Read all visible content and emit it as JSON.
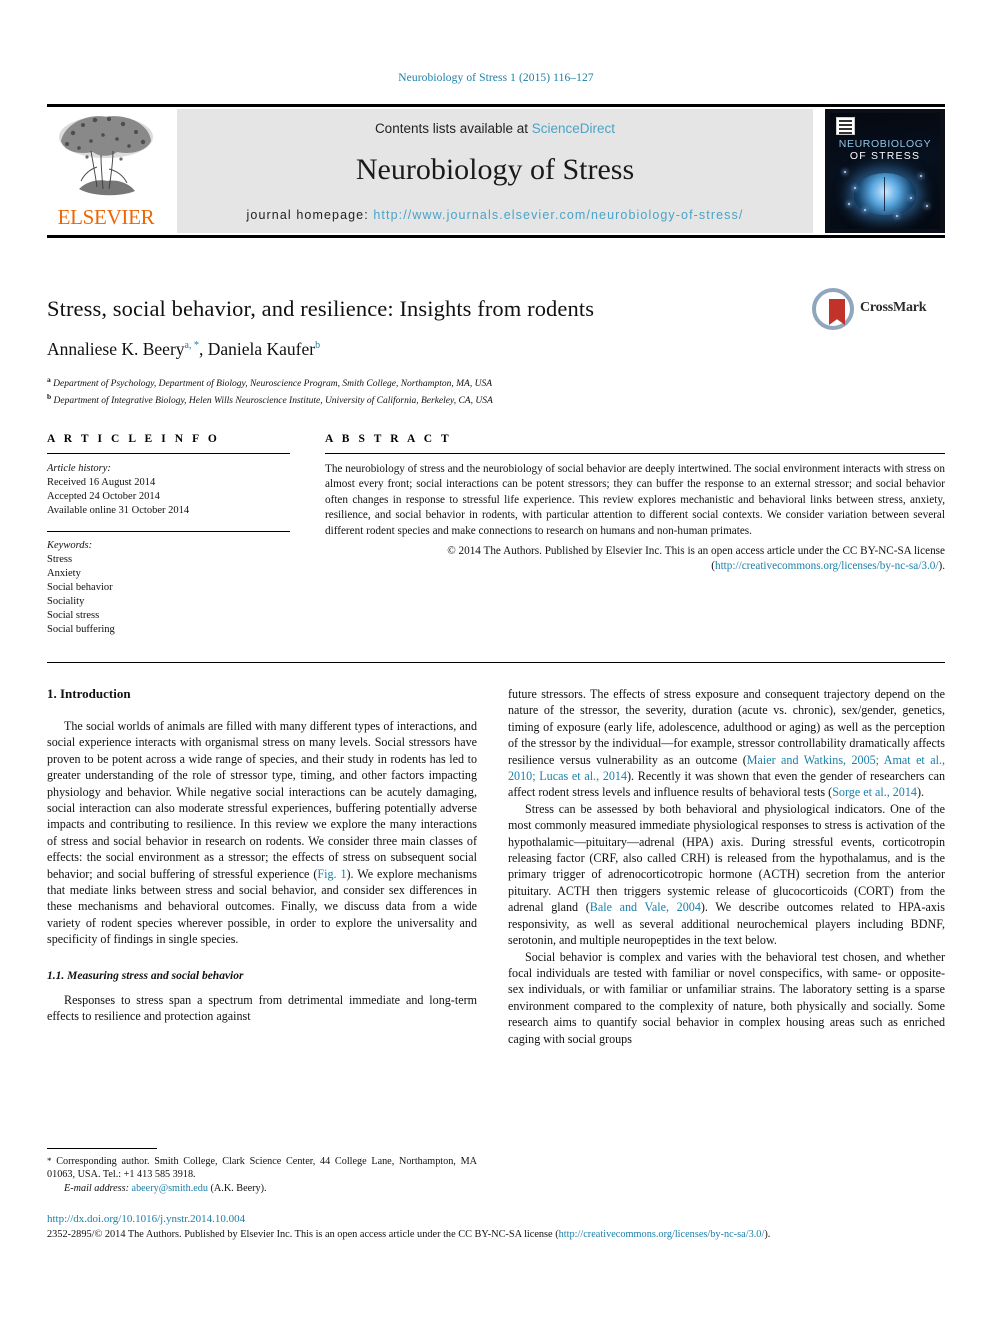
{
  "running_head": "Neurobiology of Stress 1 (2015) 116–127",
  "masthead": {
    "contents_prefix": "Contents lists available at ",
    "contents_link": "ScienceDirect",
    "journal_title": "Neurobiology of Stress",
    "homepage_prefix": "journal homepage: ",
    "homepage_url": "http://www.journals.elsevier.com/neurobiology-of-stress/",
    "publisher": "ELSEVIER",
    "cover": {
      "line1": "NEUROBIOLOGY",
      "line2": "OF STRESS"
    }
  },
  "article": {
    "title": "Stress, social behavior, and resilience: Insights from rodents",
    "authors": [
      {
        "name": "Annaliese K. Beery",
        "marks": "a, *"
      },
      {
        "name": "Daniela Kaufer",
        "marks": "b"
      }
    ],
    "authors_separator": ", ",
    "affiliations": [
      {
        "mark": "a",
        "text": "Department of Psychology, Department of Biology, Neuroscience Program, Smith College, Northampton, MA, USA"
      },
      {
        "mark": "b",
        "text": "Department of Integrative Biology, Helen Wills Neuroscience Institute, University of California, Berkeley, CA, USA"
      }
    ],
    "crossmark_label": "CrossMark"
  },
  "article_info": {
    "heading": "A R T I C L E   I N F O",
    "history_label": "Article history:",
    "history": [
      "Received 16 August 2014",
      "Accepted 24 October 2014",
      "Available online 31 October 2014"
    ],
    "keywords_label": "Keywords:",
    "keywords": [
      "Stress",
      "Anxiety",
      "Social behavior",
      "Sociality",
      "Social stress",
      "Social buffering"
    ]
  },
  "abstract": {
    "heading": "A B S T R A C T",
    "text": "The neurobiology of stress and the neurobiology of social behavior are deeply intertwined. The social environment interacts with stress on almost every front; social interactions can be potent stressors; they can buffer the response to an external stressor; and social behavior often changes in response to stressful life experience. This review explores mechanistic and behavioral links between stress, anxiety, resilience, and social behavior in rodents, with particular attention to different social contexts. We consider variation between several different rodent species and make connections to research on humans and non-human primates.",
    "copyright_prefix": "© 2014 The Authors. Published by Elsevier Inc. This is an open access article under the CC BY-NC-SA license (",
    "copyright_link": "http://creativecommons.org/licenses/by-nc-sa/3.0/",
    "copyright_suffix": ")."
  },
  "body": {
    "left": {
      "h1": "1. Introduction",
      "p1_a": "The social worlds of animals are filled with many different types of interactions, and social experience interacts with organismal stress on many levels. Social stressors have proven to be potent across a wide range of species, and their study in rodents has led to greater understanding of the role of stressor type, timing, and other factors impacting physiology and behavior. While negative social interactions can be acutely damaging, social interaction can also moderate stressful experiences, buffering potentially adverse impacts and contributing to resilience. In this review we explore the many interactions of stress and social behavior in research on rodents. We consider three main classes of effects: the social environment as a stressor; the effects of stress on subsequent social behavior; and social buffering of stressful experience (",
      "p1_link": "Fig. 1",
      "p1_b": "). We explore mechanisms that mediate links between stress and social behavior, and consider sex differences in these mechanisms and behavioral outcomes. Finally, we discuss data from a wide variety of rodent species wherever possible, in order to explore the universality and specificity of findings in single species.",
      "h2": "1.1. Measuring stress and social behavior",
      "p2": "Responses to stress span a spectrum from detrimental immediate and long-term effects to resilience and protection against"
    },
    "right": {
      "p1_a": "future stressors. The effects of stress exposure and consequent trajectory depend on the nature of the stressor, the severity, duration (acute vs. chronic), sex/gender, genetics, timing of exposure (early life, adolescence, adulthood or aging) as well as the perception of the stressor by the individual—for example, stressor controllability dramatically affects resilience versus vulnerability as an outcome (",
      "p1_link1": "Maier and Watkins, 2005; Amat et al., 2010; Lucas et al., 2014",
      "p1_b": "). Recently it was shown that even the gender of researchers can affect rodent stress levels and influence results of behavioral tests (",
      "p1_link2": "Sorge et al., 2014",
      "p1_c": ").",
      "p2_a": "Stress can be assessed by both behavioral and physiological indicators. One of the most commonly measured immediate physiological responses to stress is activation of the hypothalamic—pituitary—adrenal (HPA) axis. During stressful events, corticotropin releasing factor (CRF, also called CRH) is released from the hypothalamus, and is the primary trigger of adrenocorticotropic hormone (ACTH) secretion from the anterior pituitary. ACTH then triggers systemic release of glucocorticoids (CORT) from the adrenal gland (",
      "p2_link": "Bale and Vale, 2004",
      "p2_b": "). We describe outcomes related to HPA-axis responsivity, as well as several additional neurochemical players including BDNF, serotonin, and multiple neuropeptides in the text below.",
      "p3": "Social behavior is complex and varies with the behavioral test chosen, and whether focal individuals are tested with familiar or novel conspecifics, with same- or opposite-sex individuals, or with familiar or unfamiliar strains. The laboratory setting is a sparse environment compared to the complexity of nature, both physically and socially. Some research aims to quantify social behavior in complex housing areas such as enriched caging with social groups"
    }
  },
  "footnote": {
    "star": "*",
    "corresponding": " Corresponding author. Smith College, Clark Science Center, 44 College Lane, Northampton, MA 01063, USA. Tel.: +1 413 585 3918.",
    "email_label": "E-mail address:",
    "email": "abeery@smith.edu",
    "email_suffix": " (A.K. Beery)."
  },
  "bottom": {
    "doi": "http://dx.doi.org/10.1016/j.ynstr.2014.10.004",
    "license_prefix": "2352-2895/© 2014 The Authors. Published by Elsevier Inc. This is an open access article under the CC BY-NC-SA license (",
    "license_link": "http://creativecommons.org/licenses/by-nc-sa/3.0/",
    "license_suffix": ")."
  },
  "colors": {
    "link": "#1a7fa8",
    "elsevier_orange": "#ec6608",
    "masthead_bg": "#e5e5e5",
    "crossmark_red": "#c1332a"
  }
}
